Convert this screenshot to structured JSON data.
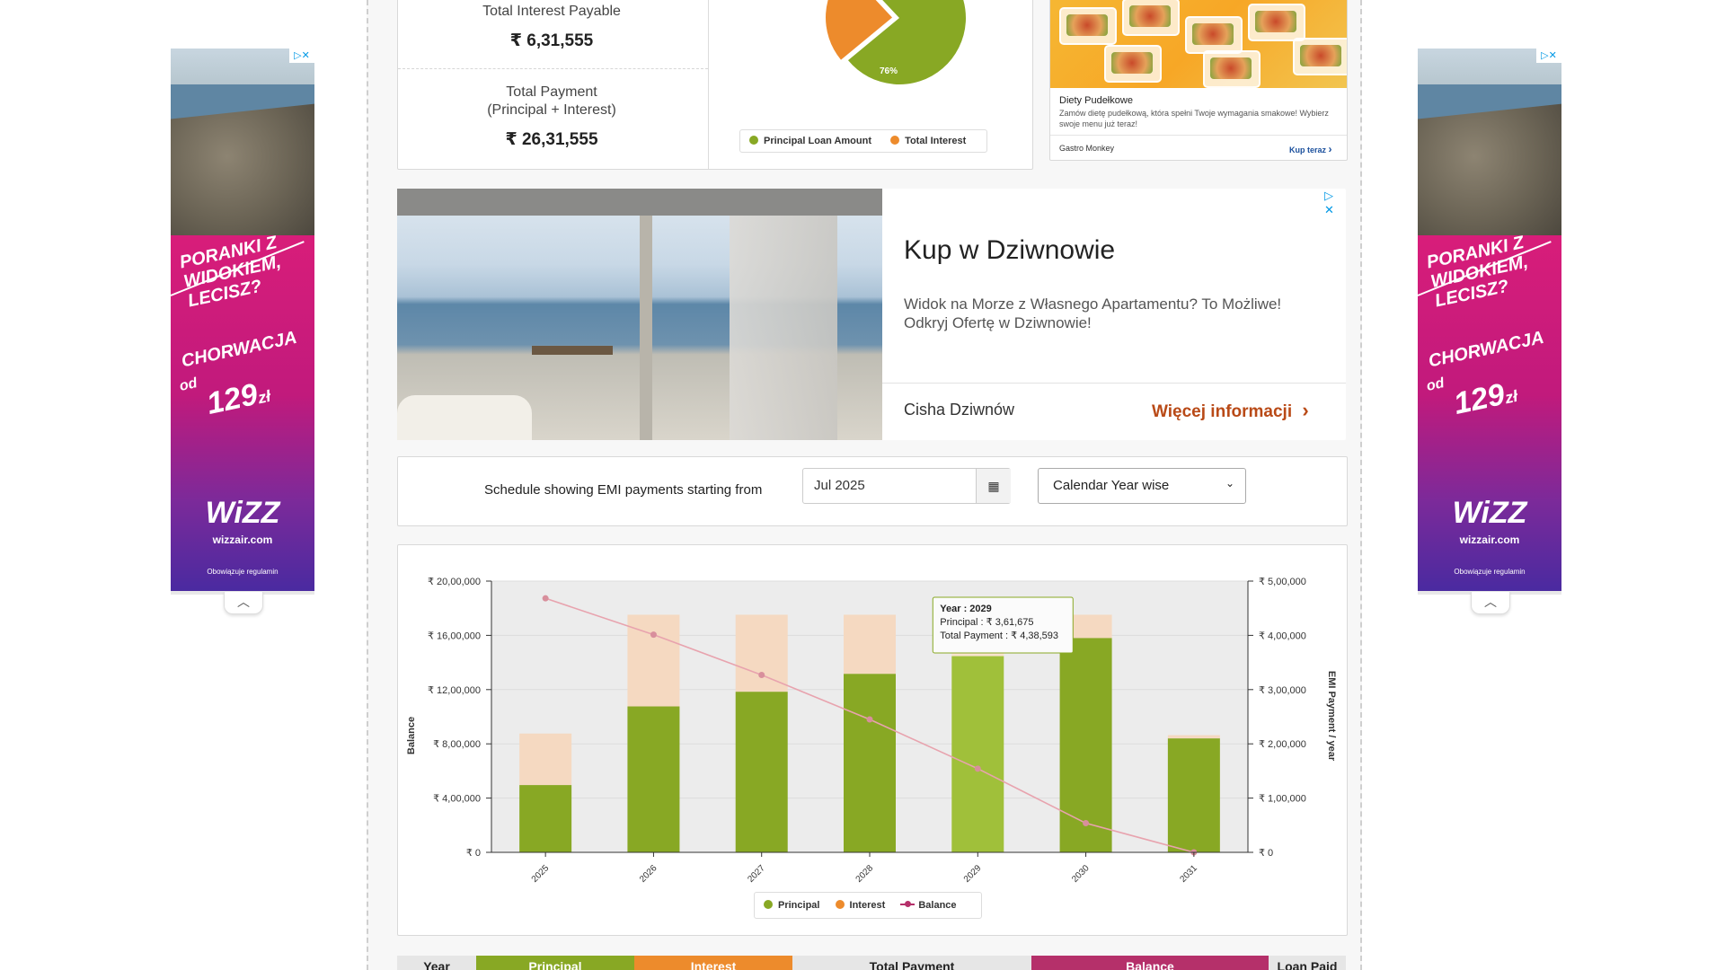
{
  "side_ads": {
    "headline": "PORANKI Z WIDOKIEM, LECISZ?",
    "destination": "CHORWACJA",
    "price_prefix": "od",
    "price": "129",
    "price_unit": "zł",
    "brand": "WiZZ",
    "url": "wizzair.com",
    "terms": "Obowiązuje regulamin",
    "colors": {
      "pink": "#d81d7a",
      "purple": "#4a2aa0"
    }
  },
  "summary": {
    "interest_label": "Total Interest Payable",
    "interest_value": "₹ 6,31,555",
    "payment_label_line1": "Total Payment",
    "payment_label_line2": "(Principal + Interest)",
    "payment_value": "₹ 26,31,555"
  },
  "pie": {
    "principal_pct_label": "76%",
    "principal_pct": 76,
    "legend": [
      {
        "label": "Principal Loan Amount",
        "color": "#88a824"
      },
      {
        "label": "Total Interest",
        "color": "#ed8b2c"
      }
    ]
  },
  "food_ad": {
    "title": "Diety Pudełkowe",
    "desc": "Zamów dietę pudełkową, która spełni Twoje wymagania smakowe! Wybierz swoje menu już teraz!",
    "advertiser": "Gastro Monkey",
    "cta": "Kup teraz"
  },
  "big_ad": {
    "title": "Kup w Dziwnowie",
    "desc_line1": "Widok na Morze z Własnego Apartamentu? To Możliwe!",
    "desc_line2": "Odkryj Ofertę w Dziwnowie!",
    "advertiser": "Cisha Dziwnów",
    "cta": "Więcej informacji"
  },
  "schedule": {
    "label": "Schedule showing EMI payments starting from",
    "start_value": "Jul 2025",
    "mode_selected": "Calendar Year wise"
  },
  "chart_data": {
    "type": "bar",
    "categories": [
      "2025",
      "2026",
      "2027",
      "2028",
      "2029",
      "2030",
      "2031"
    ],
    "series": [
      {
        "name": "Principal",
        "axis": "right",
        "color": "#88a824",
        "values": [
          124000,
          269000,
          296000,
          329000,
          361675,
          395000,
          210000
        ]
      },
      {
        "name": "Interest",
        "axis": "right",
        "color": "#f5d9c1",
        "values": [
          95000,
          169000,
          142000,
          109000,
          76918,
          43000,
          6000
        ]
      },
      {
        "name": "Balance",
        "axis": "left",
        "type": "line",
        "color": "#e8a3ae",
        "values": [
          1873000,
          1605000,
          1308000,
          980000,
          617000,
          215000,
          0
        ]
      }
    ],
    "yleft_label": "Balance",
    "yleft_ticks": [
      "₹ 20,00,000",
      "₹ 16,00,000",
      "₹ 12,00,000",
      "₹ 8,00,000",
      "₹ 4,00,000",
      "₹ 0"
    ],
    "yleft_lim": [
      0,
      2000000
    ],
    "yright_label": "EMI Payment / year",
    "yright_ticks": [
      "₹ 5,00,000",
      "₹ 4,00,000",
      "₹ 3,00,000",
      "₹ 2,00,000",
      "₹ 1,00,000",
      "₹ 0"
    ],
    "yright_lim": [
      0,
      500000
    ],
    "highlight_index": 4,
    "tooltip": {
      "line1": "Year : 2029",
      "line2": "Principal : ₹ 3,61,675",
      "line3": "Total Payment : ₹ 4,38,593"
    },
    "legend": [
      {
        "label": "Principal",
        "color": "#88a824"
      },
      {
        "label": "Interest",
        "color": "#ed8b2c"
      },
      {
        "label": "Balance",
        "color": "#b5306a"
      }
    ]
  },
  "table_header": [
    {
      "label": "Year",
      "bg": "#e6e6e6",
      "color": "#222"
    },
    {
      "label": "Principal",
      "bg": "#88a824",
      "color": "#ffffff"
    },
    {
      "label": "Interest",
      "bg": "#ed8b2c",
      "color": "#ffffff"
    },
    {
      "label": "Total Payment",
      "bg": "#e6e6e6",
      "color": "#222"
    },
    {
      "label": "Balance",
      "bg": "#b5306a",
      "color": "#ffffff"
    },
    {
      "label": "Loan Paid",
      "bg": "#e6e6e6",
      "color": "#222"
    }
  ]
}
